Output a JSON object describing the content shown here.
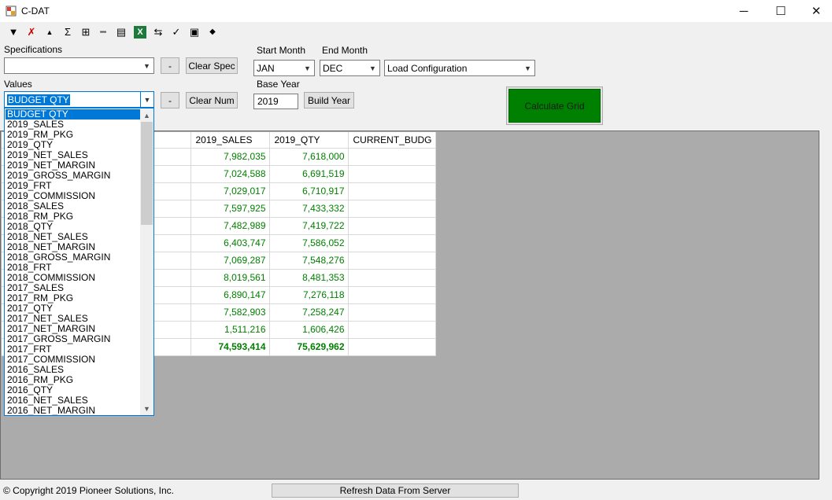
{
  "window": {
    "title": "C-DAT",
    "minimize": "─",
    "maximize": "☐",
    "close": "✕"
  },
  "toolbar": {
    "icons": [
      {
        "name": "filter-icon",
        "glyph": "▼"
      },
      {
        "name": "clear-filter-icon",
        "glyph": "✗"
      },
      {
        "name": "collapse-icon",
        "glyph": "▲"
      },
      {
        "name": "sum-icon",
        "glyph": "Σ"
      },
      {
        "name": "pivot-icon",
        "glyph": "⊞"
      },
      {
        "name": "ruler-icon",
        "glyph": "┉"
      },
      {
        "name": "layout-icon",
        "glyph": "▤"
      },
      {
        "name": "excel-icon",
        "glyph": "X"
      },
      {
        "name": "swap-icon",
        "glyph": "⇆"
      },
      {
        "name": "spell-check-icon",
        "glyph": "✓"
      },
      {
        "name": "save-icon",
        "glyph": "▣"
      },
      {
        "name": "eraser-icon",
        "glyph": "◆"
      }
    ]
  },
  "specifications": {
    "label": "Specifications",
    "value": "",
    "minus": "-",
    "clear": "Clear Spec"
  },
  "values": {
    "label": "Values",
    "value": "BUDGET QTY",
    "minus": "-",
    "clear": "Clear Num"
  },
  "start_month": {
    "label": "Start Month",
    "value": "JAN"
  },
  "end_month": {
    "label": "End Month",
    "value": "DEC"
  },
  "configuration": {
    "value": "Load Configuration"
  },
  "base_year": {
    "label": "Base Year",
    "value": "2019",
    "build": "Build Year"
  },
  "calculate": {
    "label": "Calculate Grid"
  },
  "grid": {
    "headers": [
      "",
      "",
      "2019_SALES",
      "2019_QTY",
      "CURRENT_BUDG"
    ],
    "rows": [
      {
        "sales": "7,982,035",
        "qty": "7,618,000"
      },
      {
        "sales": "7,024,588",
        "qty": "6,691,519"
      },
      {
        "sales": "7,029,017",
        "qty": "6,710,917"
      },
      {
        "sales": "7,597,925",
        "qty": "7,433,332"
      },
      {
        "sales": "7,482,989",
        "qty": "7,419,722"
      },
      {
        "sales": "6,403,747",
        "qty": "7,586,052"
      },
      {
        "sales": "7,069,287",
        "qty": "7,548,276"
      },
      {
        "sales": "8,019,561",
        "qty": "8,481,353"
      },
      {
        "sales": "6,890,147",
        "qty": "7,276,118"
      },
      {
        "sales": "7,582,903",
        "qty": "7,258,247"
      },
      {
        "sales": "1,511,216",
        "qty": "1,606,426"
      }
    ],
    "total": {
      "sales": "74,593,414",
      "qty": "75,629,962"
    }
  },
  "values_dropdown": {
    "selected": 0,
    "items": [
      "BUDGET QTY",
      "2019_SALES",
      "2019_RM_PKG",
      "2019_QTY",
      "2019_NET_SALES",
      "2019_NET_MARGIN",
      "2019_GROSS_MARGIN",
      "2019_FRT",
      "2019_COMMISSION",
      "2018_SALES",
      "2018_RM_PKG",
      "2018_QTY",
      "2018_NET_SALES",
      "2018_NET_MARGIN",
      "2018_GROSS_MARGIN",
      "2018_FRT",
      "2018_COMMISSION",
      "2017_SALES",
      "2017_RM_PKG",
      "2017_QTY",
      "2017_NET_SALES",
      "2017_NET_MARGIN",
      "2017_GROSS_MARGIN",
      "2017_FRT",
      "2017_COMMISSION",
      "2016_SALES",
      "2016_RM_PKG",
      "2016_QTY",
      "2016_NET_SALES",
      "2016_NET_MARGIN"
    ]
  },
  "status": {
    "copyright": "© Copyright 2019 Pioneer Solutions, Inc.",
    "refresh": "Refresh Data From Server"
  }
}
